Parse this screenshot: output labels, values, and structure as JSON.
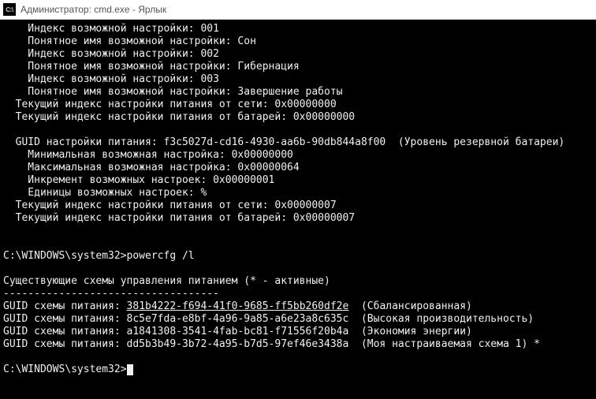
{
  "titlebar": {
    "icon_text": "C:\\",
    "title": "Администратор: cmd.exe - Ярлык"
  },
  "console": {
    "lines": [
      "    Индекс возможной настройки: 001",
      "    Понятное имя возможной настройки: Сон",
      "    Индекс возможной настройки: 002",
      "    Понятное имя возможной настройки: Гибернация",
      "    Индекс возможной настройки: 003",
      "    Понятное имя возможной настройки: Завершение работы",
      "  Текущий индекс настройки питания от сети: 0x00000000",
      "  Текущий индекс настройки питания от батарей: 0x00000000",
      "",
      "  GUID настройки питания: f3c5027d-cd16-4930-aa6b-90db844a8f00  (Уровень резервной батареи)",
      "    Минимальная возможная настройка: 0x00000000",
      "    Максимальная возможная настройка: 0x00000064",
      "    Инкремент возможных настроек: 0x00000001",
      "    Единицы возможных настроек: %",
      "  Текущий индекс настройки питания от сети: 0x00000007",
      "  Текущий индекс настройки питания от батарей: 0x00000007",
      "",
      "",
      "C:\\WINDOWS\\system32>powercfg /l",
      "",
      "Существующие схемы управления питанием (* - активные)",
      "-----------------------------------",
      "GUID схемы питания: 381b4222-f694-41f0-9685-ff5bb260df2e  (Сбалансированная)",
      "GUID схемы питания: 8c5e7fda-e8bf-4a96-9a85-a6e23a8c635c  (Высокая производительность)",
      "GUID схемы питания: a1841308-3541-4fab-bc81-f71556f20b4a  (Экономия энергии)",
      "GUID схемы питания: dd5b3b49-3b72-4a95-b7d5-97ef46e3438a  (Моя настраиваемая схема 1) *",
      "",
      "C:\\WINDOWS\\system32>"
    ],
    "underline_line_index": 22,
    "underline_start": 20,
    "underline_end": 56,
    "prompt_line_index": 27
  }
}
